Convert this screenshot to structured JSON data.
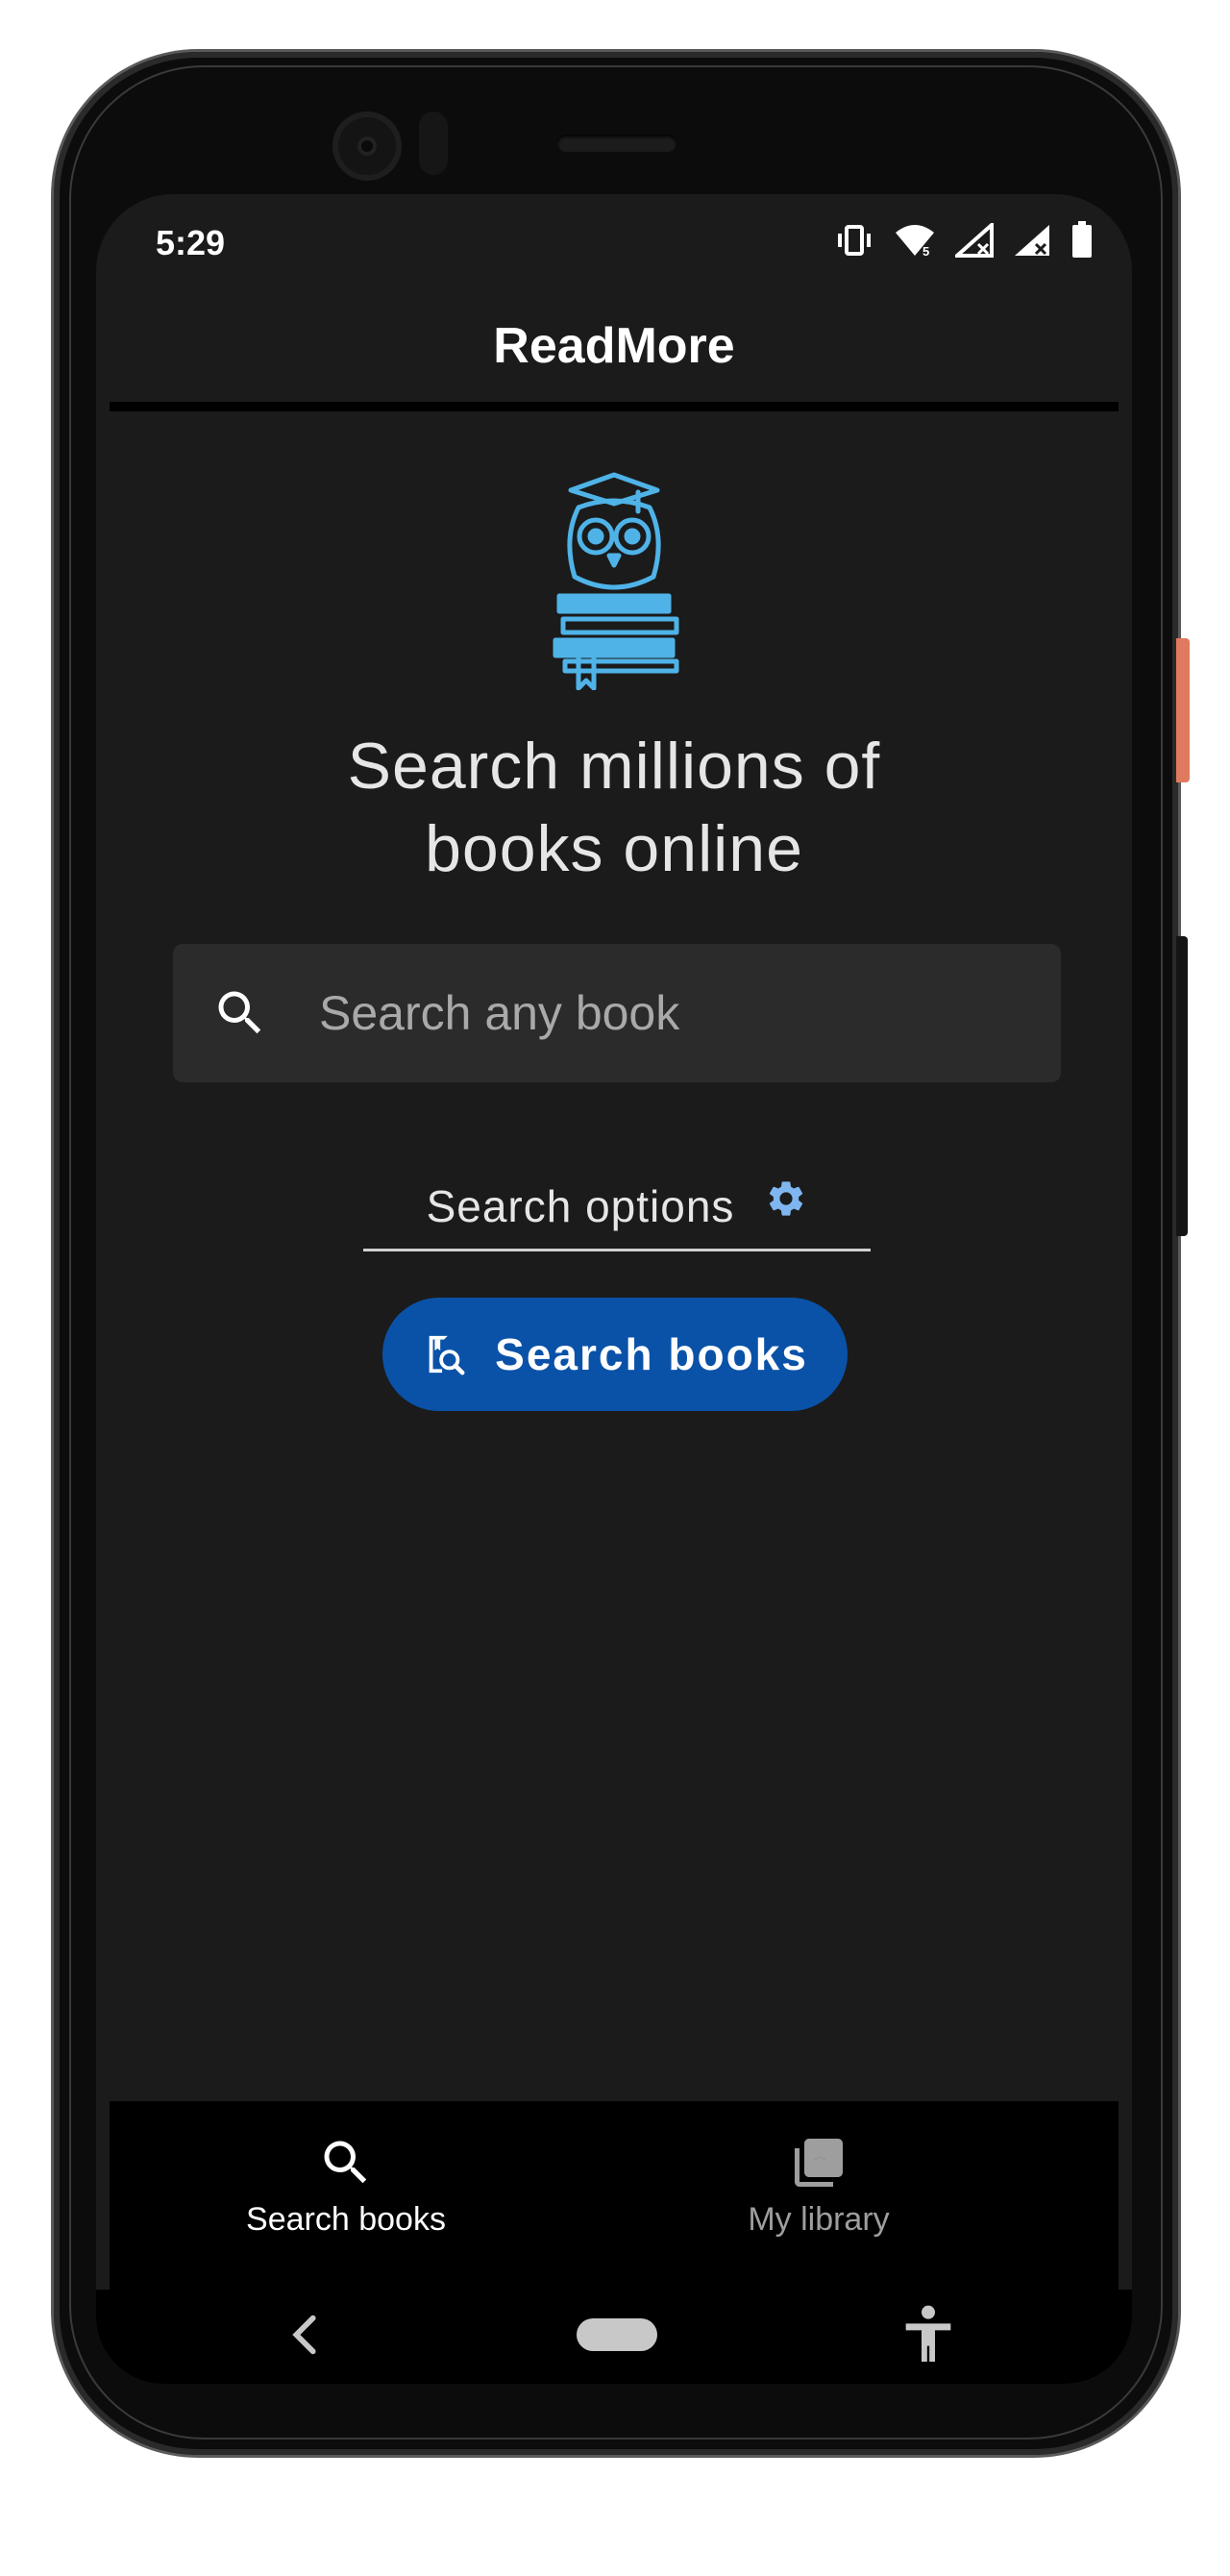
{
  "status_bar": {
    "time": "5:29",
    "icons": [
      "vibrate-icon",
      "wifi-icon",
      "signal-icon",
      "signal-icon",
      "battery-icon"
    ]
  },
  "app_bar": {
    "title": "ReadMore"
  },
  "hero": {
    "logo_icon": "owl-books-logo",
    "headline_line1": "Search millions of",
    "headline_line2": "books online"
  },
  "search": {
    "placeholder": "Search any book",
    "value": ""
  },
  "search_options": {
    "label": "Search options",
    "icon": "gear-icon"
  },
  "search_button": {
    "label": "Search books",
    "icon": "book-search-icon"
  },
  "bottom_nav": {
    "items": [
      {
        "label": "Search books",
        "icon": "search-icon",
        "selected": true
      },
      {
        "label": "My library",
        "icon": "library-icon",
        "selected": false
      }
    ]
  },
  "colors": {
    "background": "#1b1b1b",
    "accent": "#0a52a8",
    "logo": "#4fb3e8",
    "gear": "#7fb6f0"
  }
}
